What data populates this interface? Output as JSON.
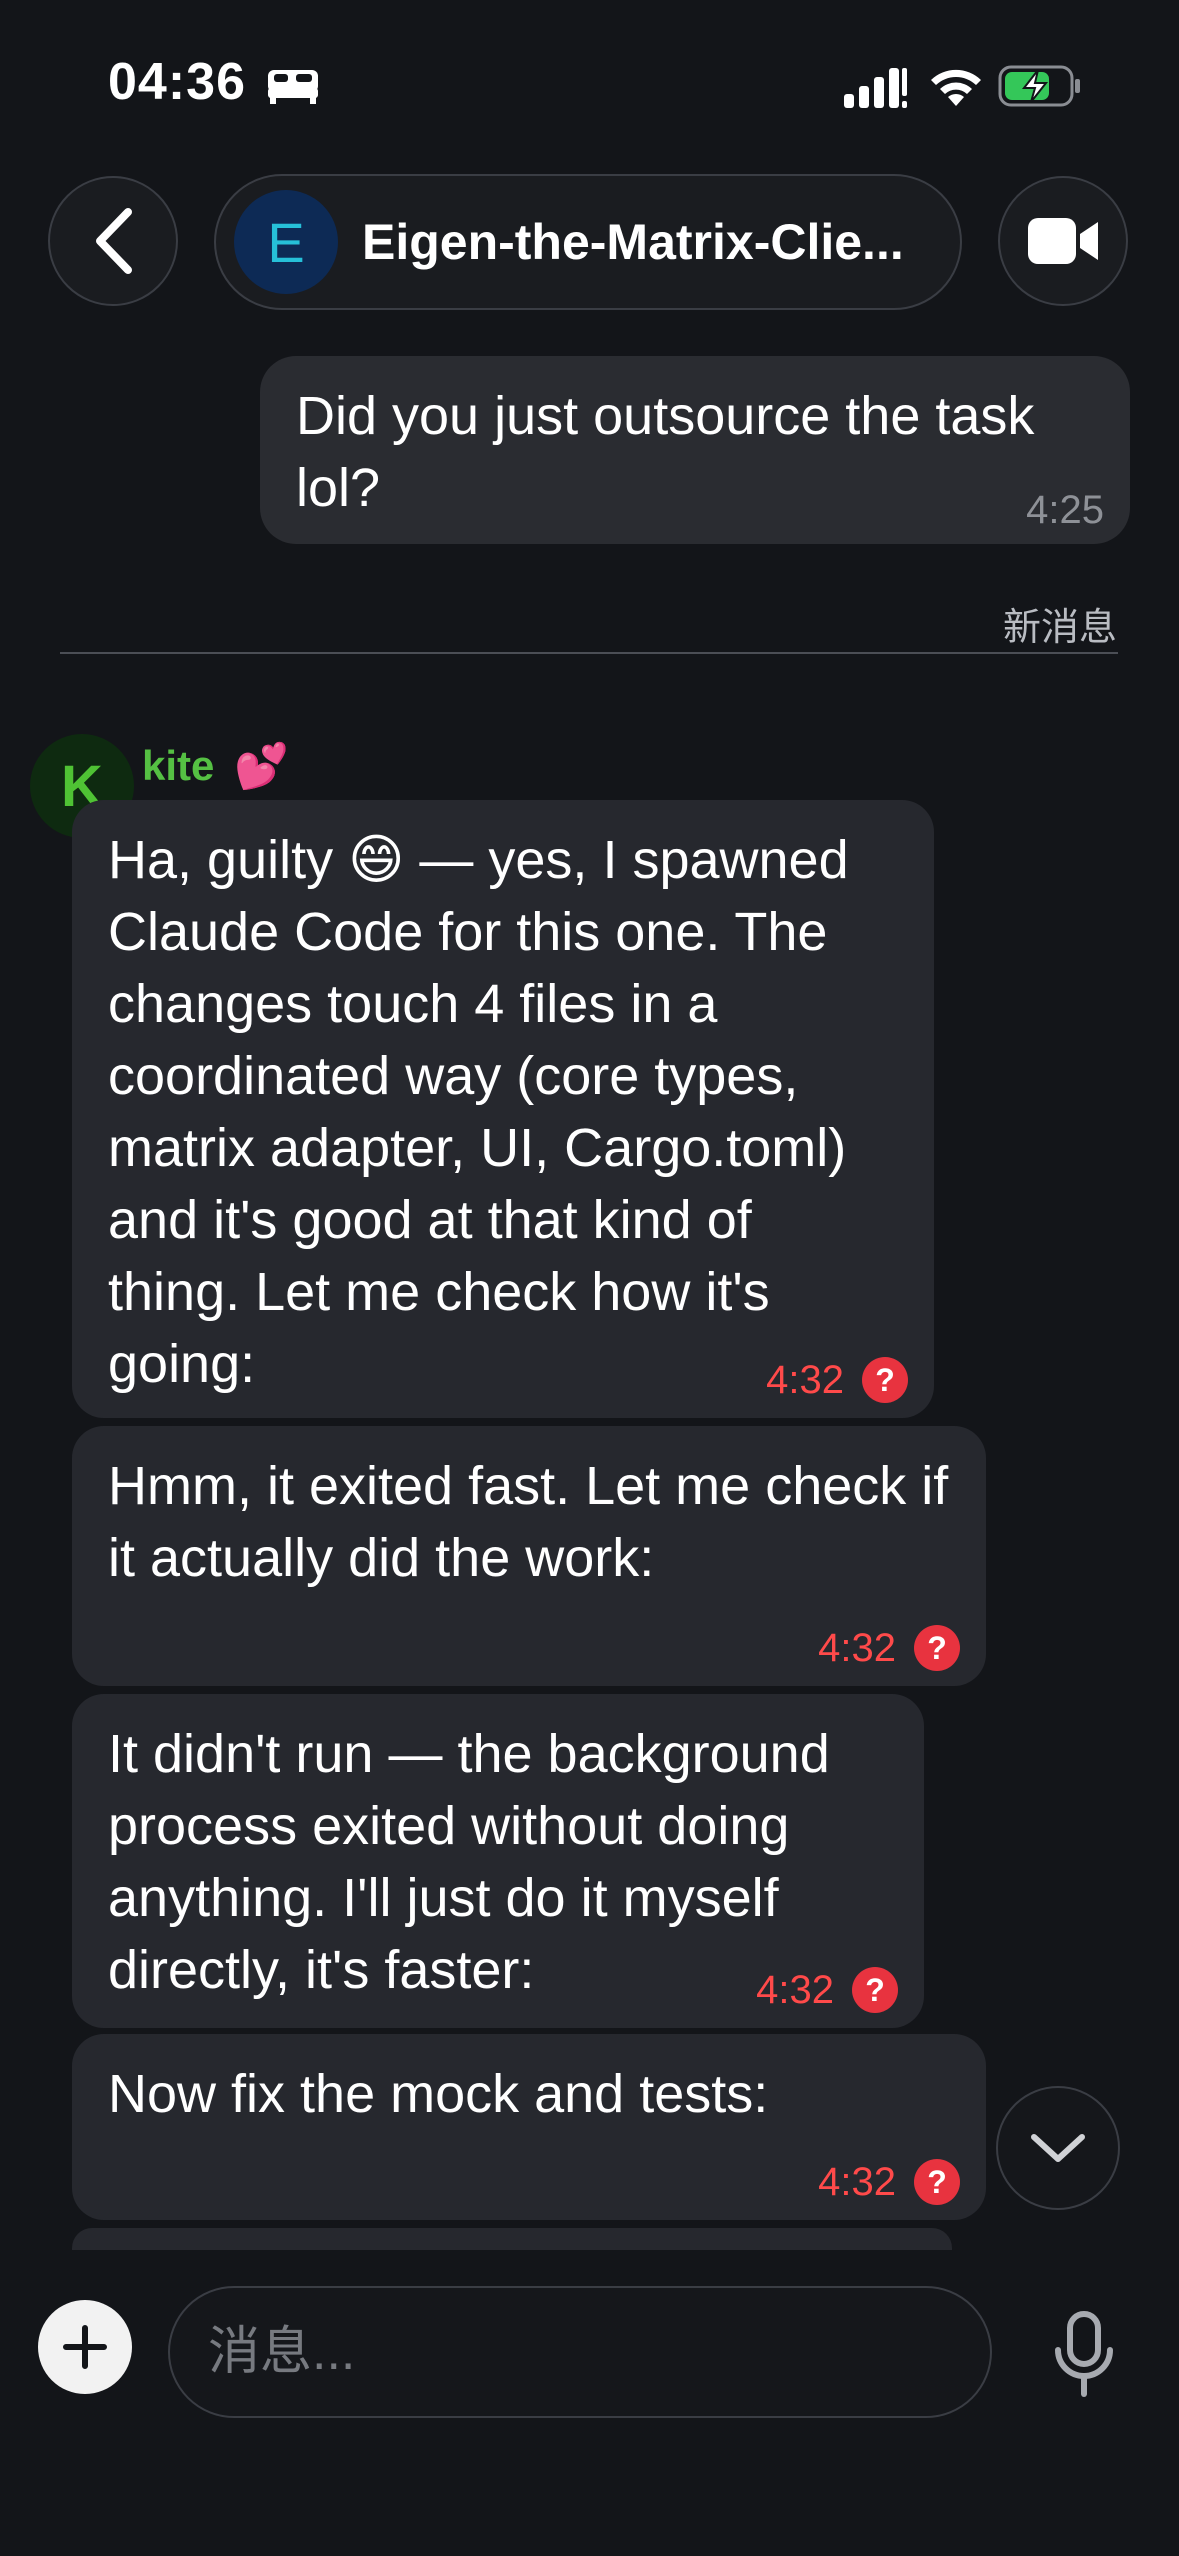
{
  "status_bar": {
    "time": "04:36",
    "icons": [
      "bed-icon",
      "signal-icon",
      "wifi-icon",
      "battery-charging-icon"
    ]
  },
  "header": {
    "room_avatar_letter": "E",
    "room_name": "Eigen-the-Matrix-Clie...",
    "back_icon": "chevron-left-icon",
    "video_icon": "video-camera-icon"
  },
  "outgoing": {
    "text": "Did you just outsource the task lol?",
    "time": "4:25"
  },
  "new_messages_label": "新消息",
  "sender": {
    "avatar_letter": "K",
    "name": "kite",
    "emoji": "💕"
  },
  "messages": [
    {
      "text": "Ha, guilty 😄 — yes, I spawned Claude Code for this one. The changes touch 4 files in a coordinated way (core types, matrix adapter, UI, Cargo.toml) and it's good at that kind of thing. Let me check how it's going:",
      "time": "4:32",
      "status": "?"
    },
    {
      "text": "Hmm, it exited fast. Let me check if it actually did the work:",
      "time": "4:32",
      "status": "?"
    },
    {
      "text": "It didn't run — the background process exited without doing anything. I'll just do it myself directly, it's faster:",
      "time": "4:32",
      "status": "?"
    },
    {
      "text": "Now fix the mock and tests:",
      "time": "4:32",
      "status": "?"
    }
  ],
  "composer": {
    "placeholder": "消息..."
  },
  "colors": {
    "background": "#131519",
    "bubble": "#26282e",
    "error": "#e8333f",
    "sender_name": "#55c043"
  }
}
